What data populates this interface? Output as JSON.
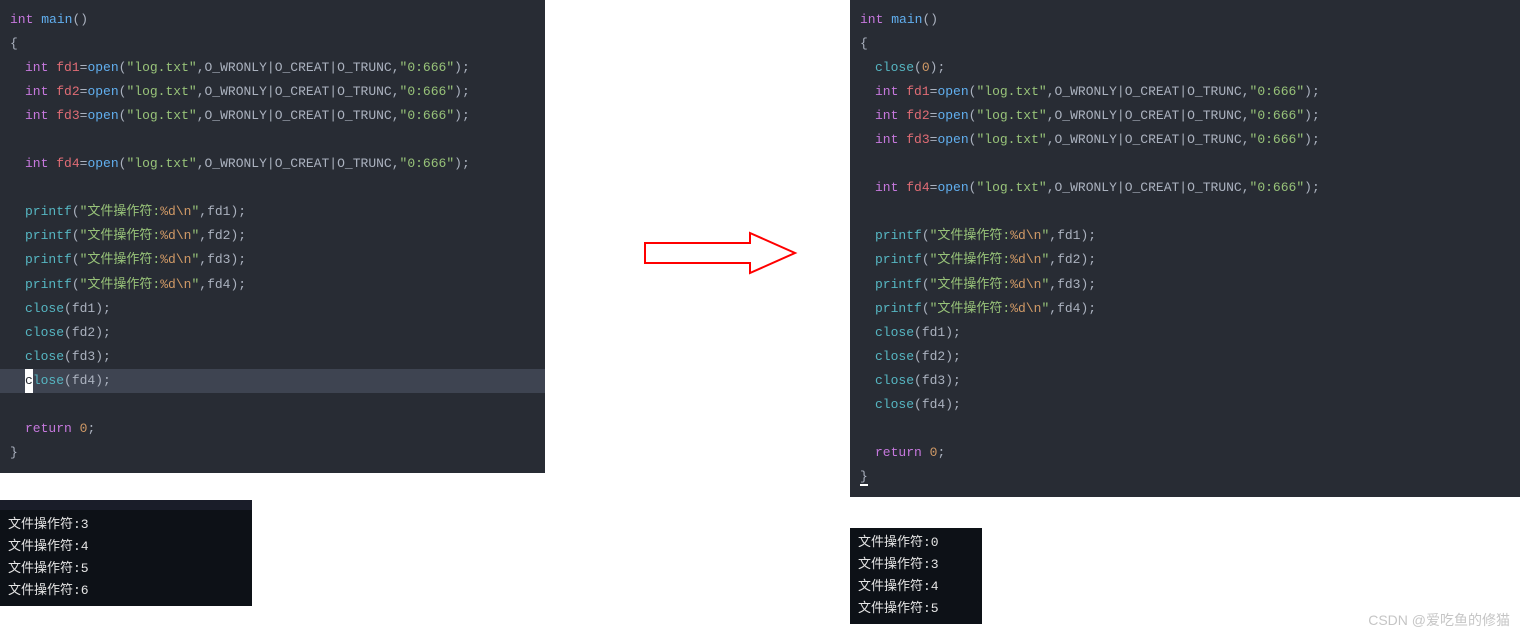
{
  "left": {
    "l0": "int",
    "l0b": "main",
    "l0c": "()",
    "l1": "{",
    "fd1_a": "int",
    "fd1_b": "fd1",
    "fd1_c": "=",
    "fd1_d": "open",
    "fd1_e": "(",
    "fd1_f": "\"log.txt\"",
    "fd1_g": ",O_WRONLY|O_CREAT|O_TRUNC,",
    "fd1_h": "\"0:666\"",
    "fd1_i": ");",
    "fd2_b": "fd2",
    "fd3_b": "fd3",
    "fd4_b": "fd4",
    "pf": "printf",
    "pf_s1": "\"文件操作符:",
    "pf_s2": "%d",
    "pf_s3": "\\n",
    "pf_s4": "\"",
    "pf_a1": ",fd1);",
    "pf_a2": ",fd2);",
    "pf_a3": ",fd3);",
    "pf_a4": ",fd4);",
    "cl": "close",
    "cl1": "(fd1);",
    "cl2": "(fd2);",
    "cl3": "(fd3);",
    "cl4": "(fd4);",
    "cl4_c": "c",
    "cl4_rest": "lose",
    "ret": "return",
    "ret_v": "0",
    "ret_s": ";",
    "rb": "}"
  },
  "right": {
    "close0": "close",
    "close0_a": "(",
    "close0_n": "0",
    "close0_b": ");"
  },
  "term_left": {
    "o1": "文件操作符:3",
    "o2": "文件操作符:4",
    "o3": "文件操作符:5",
    "o4": "文件操作符:6"
  },
  "term_right": {
    "o1": "文件操作符:0",
    "o2": "文件操作符:3",
    "o3": "文件操作符:4",
    "o4": "文件操作符:5"
  },
  "watermark": "CSDN @爱吃鱼的修猫"
}
